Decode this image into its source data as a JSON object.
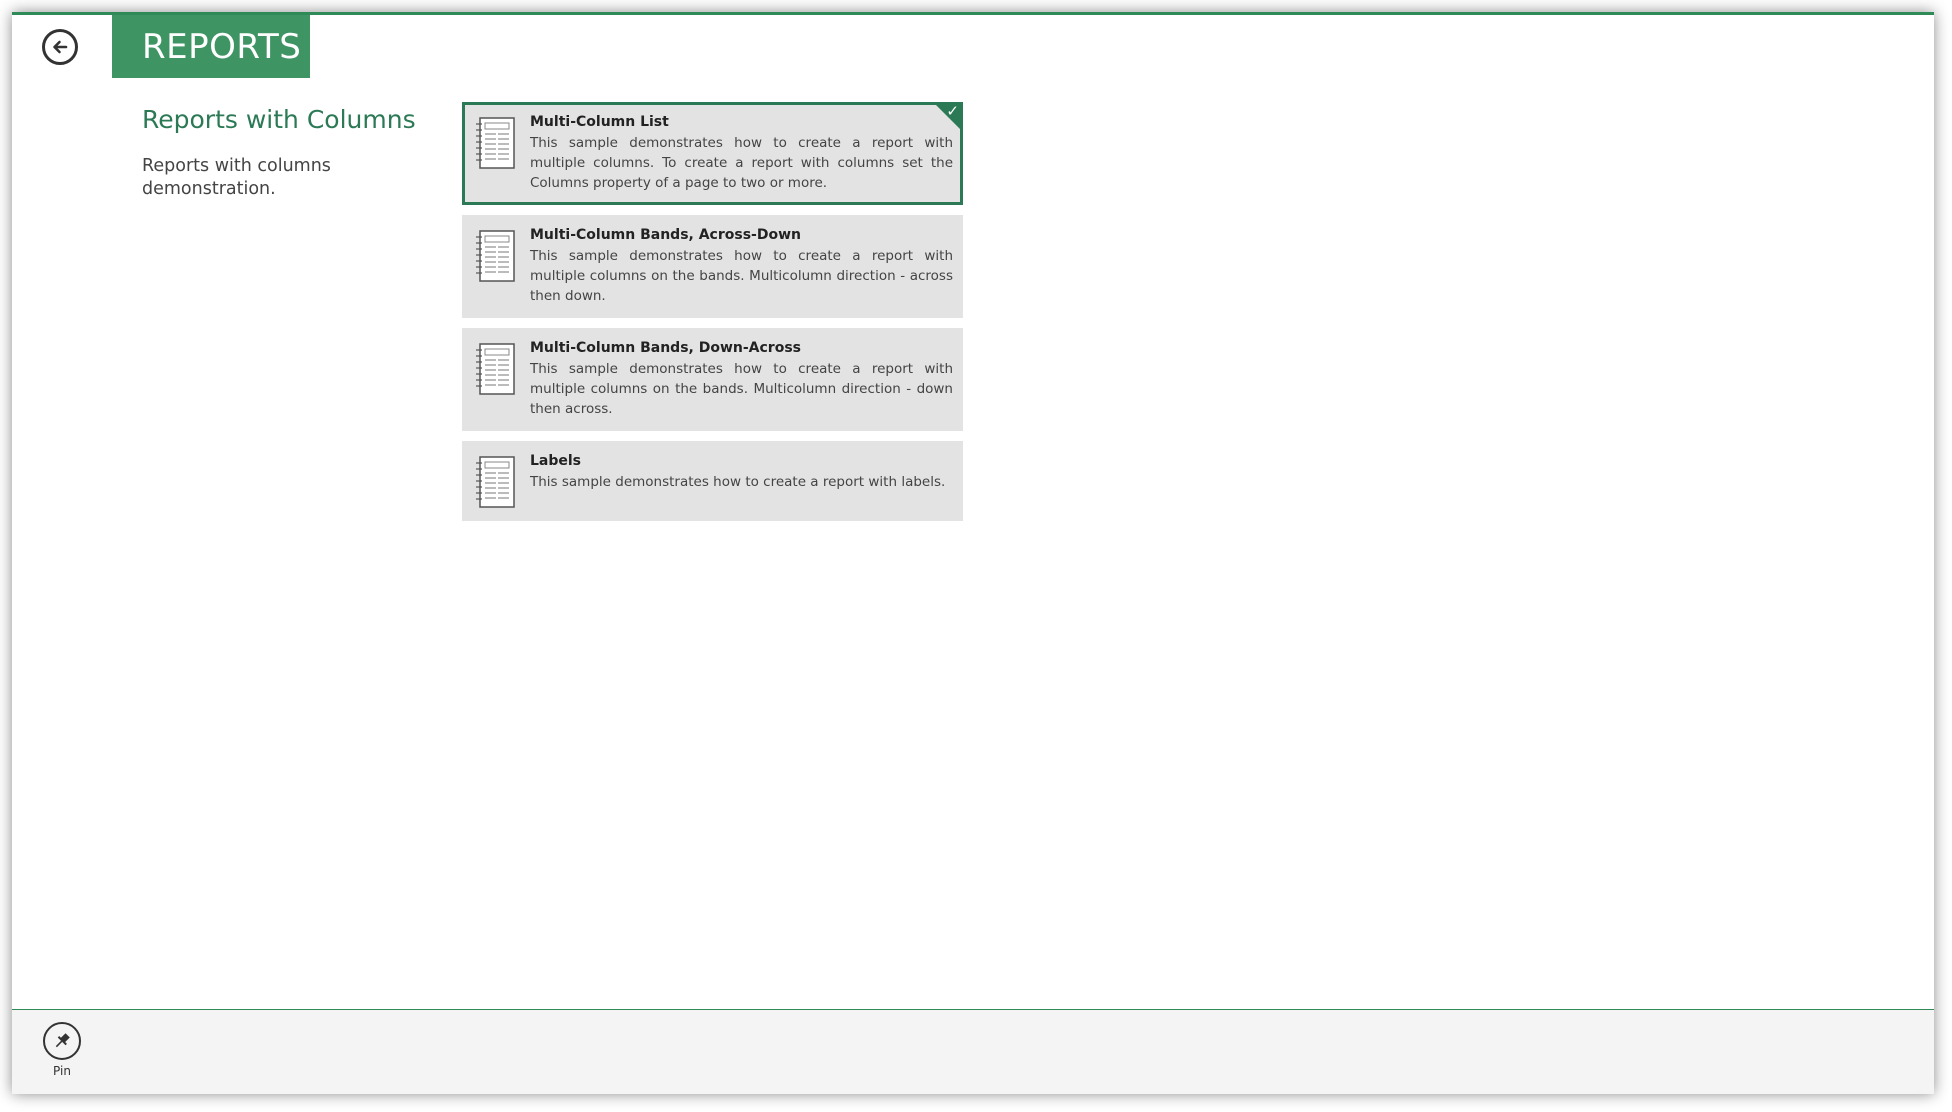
{
  "header": {
    "title": "REPORTS"
  },
  "group": {
    "title": "Reports with Columns",
    "description": "Reports with columns demonstration."
  },
  "items": [
    {
      "name": "Multi-Column List",
      "description": "This sample demonstrates how to create a report with multiple columns. To create a report with columns set the Columns property of a page to two or more.",
      "selected": true
    },
    {
      "name": "Multi-Column Bands, Across-Down",
      "description": "This sample demonstrates how to create a report with multiple columns on the bands. Multicolumn direction - across then down.",
      "selected": false
    },
    {
      "name": "Multi-Column Bands, Down-Across",
      "description": "This sample demonstrates how to create a report with multiple columns on the bands. Multicolumn direction - down then across.",
      "selected": false
    },
    {
      "name": "Labels",
      "description": "This sample demonstrates how to create a report with labels.",
      "selected": false
    }
  ],
  "app_bar": {
    "pin_label": "Pin"
  },
  "colors": {
    "accent": "#3f9464",
    "accent_dark": "#2c7a55",
    "item_bg": "#e3e3e3",
    "app_bar_bg": "#f4f4f4"
  },
  "icons": {
    "back": "arrow-left-circle-icon",
    "item": "report-document-icon",
    "selected": "checkmark-icon",
    "pin": "pin-icon"
  }
}
